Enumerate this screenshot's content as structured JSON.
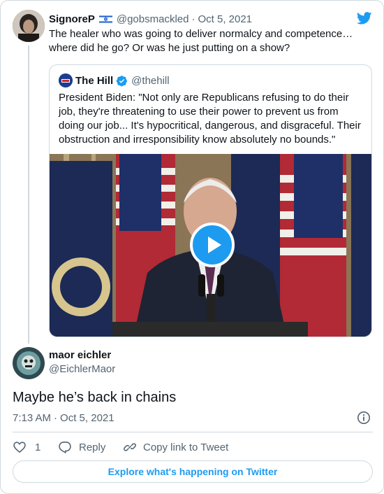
{
  "tweet_parent": {
    "display_name": "SignoreP",
    "handle": "@gobsmackled",
    "separator": "·",
    "date": "Oct 5, 2021",
    "text": "The healer who was going to deliver normalcy and competence… where did he go? Or was he just putting on a show?",
    "flag_icon": "israel-flag-icon"
  },
  "quoted": {
    "display_name": "The Hill",
    "handle": "@thehill",
    "verified_icon": "verified-badge-icon",
    "text": "President Biden: \"Not only are Republicans refusing to do their job, they're threatening to use their power to prevent us from doing our job... It's hypocritical, dangerous, and disgraceful. Their obstruction and irresponsibility know absolutely no bounds.\"",
    "media_icon": "play-icon"
  },
  "reply": {
    "display_name": "maor eichler",
    "handle": "@EichlerMaor",
    "text": "Maybe he’s back in chains",
    "time": "7:13 AM",
    "separator": "·",
    "date": "Oct 5, 2021"
  },
  "actions": {
    "like_count": "1",
    "reply_label": "Reply",
    "copy_label": "Copy link to Tweet"
  },
  "explore_label": "Explore what's happening on Twitter",
  "colors": {
    "accent": "#1d9bf0",
    "muted": "#536471",
    "border": "#cfd9de"
  }
}
